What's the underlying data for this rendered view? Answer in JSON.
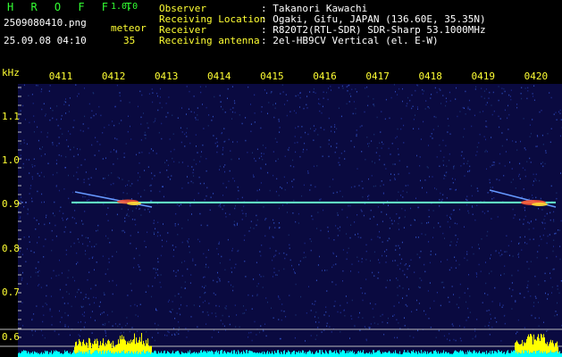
{
  "app": {
    "title": "H R O F F T",
    "version": "1.0.0"
  },
  "capture": {
    "filename": "2509080410.png",
    "datetime": "25.09.08 04:10",
    "mode_label": "meteor",
    "meteor_count": "35"
  },
  "info": [
    {
      "label": "Observer",
      "value": ": Takanori Kawachi"
    },
    {
      "label": "Receiving Location",
      "value": ": Ogaki, Gifu, JAPAN (136.60E, 35.35N)"
    },
    {
      "label": "Receiver",
      "value": ": R820T2(RTL-SDR) SDR-Sharp 53.1000MHz"
    },
    {
      "label": "Receiving antenna",
      "value": ": 2el-HB9CV Vertical (el. E-W)"
    }
  ],
  "spectrogram": {
    "freq_unit": "kHz",
    "freq_ticks": [
      "1.1",
      "1.0",
      "0.9",
      "0.8",
      "0.7",
      "0.6"
    ],
    "freq_tick_values": [
      1.1,
      1.0,
      0.9,
      0.8,
      0.7,
      0.6
    ],
    "time_ticks": [
      "0411",
      "0412",
      "0413",
      "0414",
      "0415",
      "0416",
      "0417",
      "0418",
      "0419",
      "0420"
    ],
    "carrier_freq_khz": 0.905,
    "colors": {
      "background": "#0a0a40",
      "carrier": "#66ffcc",
      "meteor_hot": "#ff5533",
      "histogram_yellow": "#ffff00",
      "histogram_cyan": "#00ffff",
      "label": "#ffff33"
    }
  }
}
